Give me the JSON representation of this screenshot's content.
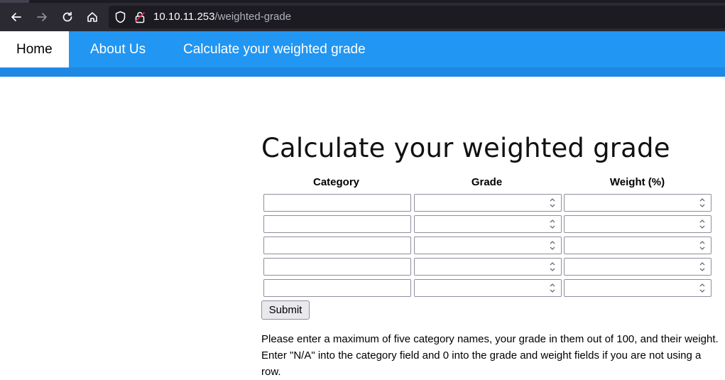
{
  "browser": {
    "url_host": "10.10.11.253",
    "url_path": "/weighted-grade",
    "icons": [
      "back-arrow-icon",
      "forward-arrow-icon",
      "reload-icon",
      "home-icon",
      "shield-icon",
      "lock-icon"
    ]
  },
  "nav": {
    "items": [
      {
        "label": "Home",
        "active": true
      },
      {
        "label": "About Us",
        "active": false
      },
      {
        "label": "Calculate your weighted grade",
        "active": false
      }
    ],
    "color": "#2196f3"
  },
  "main": {
    "title": "Calculate your weighted grade",
    "table": {
      "headers": [
        "Category",
        "Grade",
        "Weight (%)"
      ],
      "rows": [
        {
          "category": "",
          "grade": "",
          "weight": ""
        },
        {
          "category": "",
          "grade": "",
          "weight": ""
        },
        {
          "category": "",
          "grade": "",
          "weight": ""
        },
        {
          "category": "",
          "grade": "",
          "weight": ""
        },
        {
          "category": "",
          "grade": "",
          "weight": ""
        }
      ]
    },
    "submit_label": "Submit",
    "instructions": [
      "Please enter a maximum of five category names, your grade in them out of 100, and their weight.",
      "Enter \"N/A\" into the category field and 0 into the grade and weight fields if you are not using a row."
    ]
  }
}
